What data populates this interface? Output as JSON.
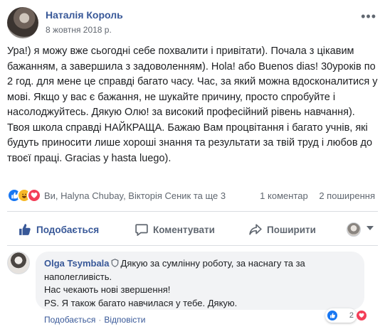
{
  "post": {
    "author": "Наталія Король",
    "date": "8 жовтня 2018 р.",
    "more_label": "•••",
    "text": "Ура!) я можу вже сьогодні себе похвалити і привітати). Почала з цікавим бажанням, а завершила з задоволенням). Hola! або Buenos dias! 30уроків по 2 год. для мене це справді багато часу. Час, за який можна вдосконалитися у мові. Якщо у вас є бажання, не шукайте причину, просто спробуйте і насолоджуйтесь. Дякую Олю! за високий професійний рівень навчання). Твоя школа справді НАЙКРАЩА. Бажаю Вам процвітання і багато учнів, які будуть приносити лише хороші знання та результати за твій труд і любов до твоєї праці. Gracias y hasta luego)."
  },
  "stats": {
    "reactors": "Ви, Halyna Chubay, Вікторія Сеник та ще 3",
    "comments": "1 коментар",
    "shares": "2 поширення"
  },
  "actions": {
    "like": "Подобається",
    "comment": "Коментувати",
    "share": "Поширити"
  },
  "comment": {
    "author": "Olga Tsymbala",
    "line1": "Дякую за сумлінну роботу, за наснагу та за наполегливість.",
    "line2": "Нас чекають нові звершення!",
    "line3": "PS. Я також багато навчилася у тебе. Дякую.",
    "like_link": "Подобається",
    "reply_link": "Відповісти",
    "reaction_count": "2"
  },
  "colors": {
    "link": "#385898",
    "like_blue": "#1877f2",
    "haha_yellow": "#f7b928",
    "love_red": "#f33e58"
  },
  "icons": [
    "more-icon",
    "globe-icon",
    "like-reaction-icon",
    "haha-reaction-icon",
    "love-reaction-icon",
    "thumbs-up-icon",
    "comment-icon",
    "share-icon",
    "shield-icon"
  ]
}
